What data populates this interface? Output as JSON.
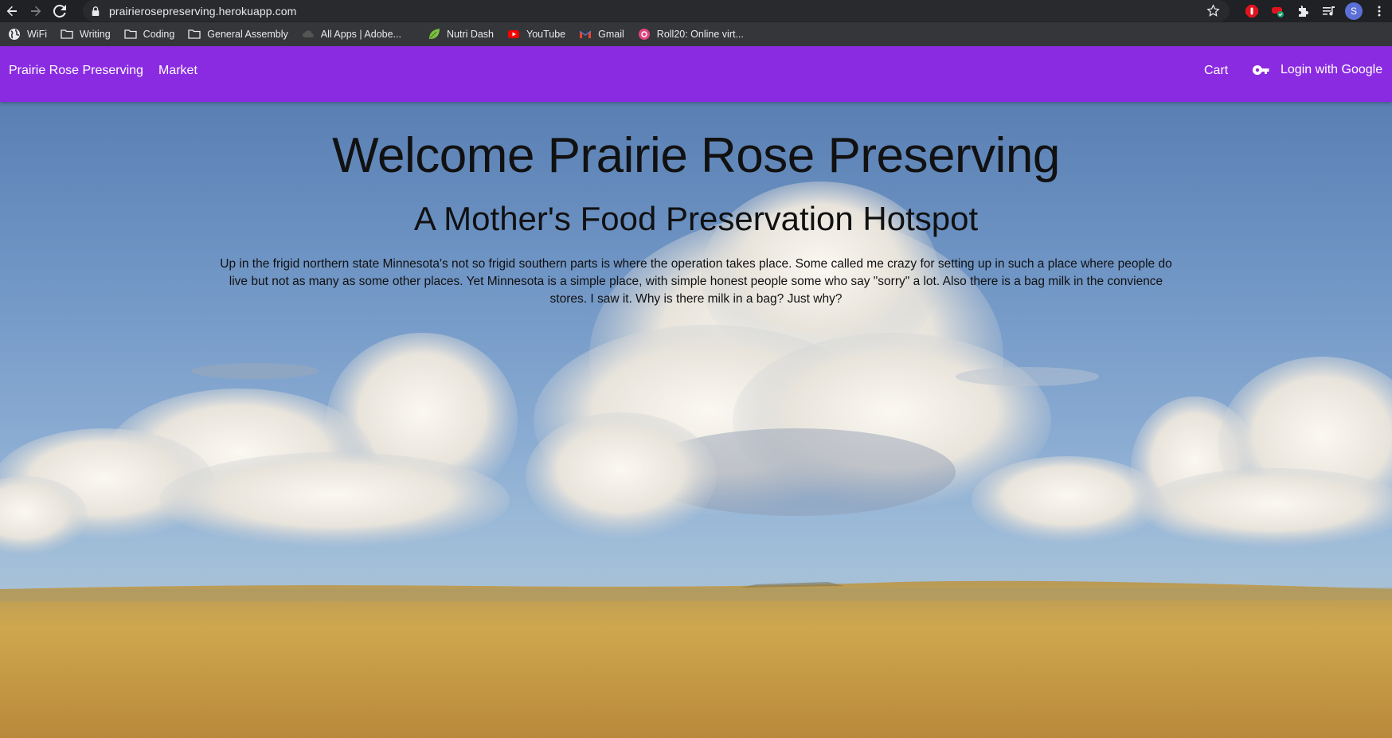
{
  "browser": {
    "url": "prairierosepreserving.herokuapp.com",
    "profile_initial": "S",
    "bookmarks": [
      "WiFi",
      "Writing",
      "Coding",
      "General Assembly",
      "All Apps | Adobe...",
      "Nutri Dash",
      "YouTube",
      "Gmail",
      "Roll20: Online virt..."
    ]
  },
  "navbar": {
    "brand": "Prairie Rose Preserving",
    "market": "Market",
    "cart": "Cart",
    "login": "Login with Google",
    "color": "#8a2be2"
  },
  "hero": {
    "title": "Welcome Prairie Rose Preserving",
    "subtitle": "A Mother's Food Preservation Hotspot",
    "blurb": "Up in the frigid northern state Minnesota's not so frigid southern parts is where the operation takes place. Some called me crazy for setting up in such a place where people do live but not as many as some other places. Yet Minnesota is a simple place, with simple honest people some who say \"sorry\" a lot. Also there is a bag milk in the convience stores. I saw it. Why is there milk in a bag? Just why?"
  }
}
